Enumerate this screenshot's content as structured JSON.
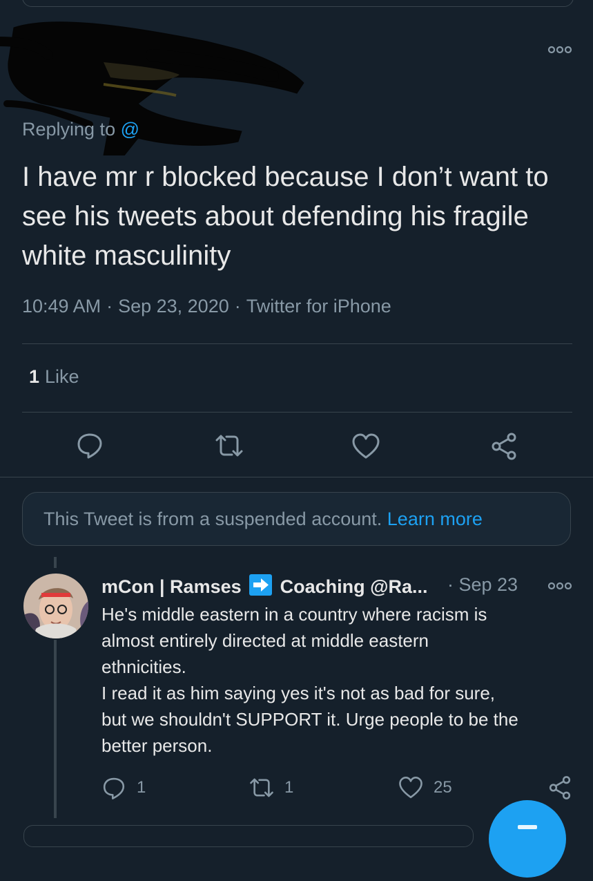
{
  "tweet": {
    "replying_label": "Replying to",
    "replying_handle": "@",
    "text": "I have mr r blocked because I don’t want to see his tweets about defending his fragile white masculinity",
    "time": "10:49 AM",
    "date": "Sep 23, 2020",
    "source": "Twitter for iPhone",
    "separator": "·",
    "like_count": "1",
    "like_label": "Like"
  },
  "suspended": {
    "message": "This Tweet is from a suspended account.",
    "link": "Learn more"
  },
  "reply": {
    "name_part1": "mCon | Ramses",
    "name_part2": "Coaching @Ra...",
    "arrow_glyph": "➜",
    "date": "· Sep 23",
    "lines": [
      "He's middle eastern in a country where racism is",
      "almost entirely directed at middle eastern",
      "ethnicities.",
      "I read it as him saying yes it's not as bad for sure,",
      "but we shouldn't SUPPORT it. Urge people to be the",
      "better person."
    ],
    "reply_count": "1",
    "retweet_count": "1",
    "like_count": "25"
  },
  "colors": {
    "background": "#15202b",
    "accent": "#1da1f2",
    "muted": "#8899a6",
    "border": "#38444d"
  },
  "icons": [
    "more-icon",
    "reply-icon",
    "retweet-icon",
    "heart-icon",
    "share-icon",
    "arrow-right-icon",
    "compose-fab"
  ]
}
